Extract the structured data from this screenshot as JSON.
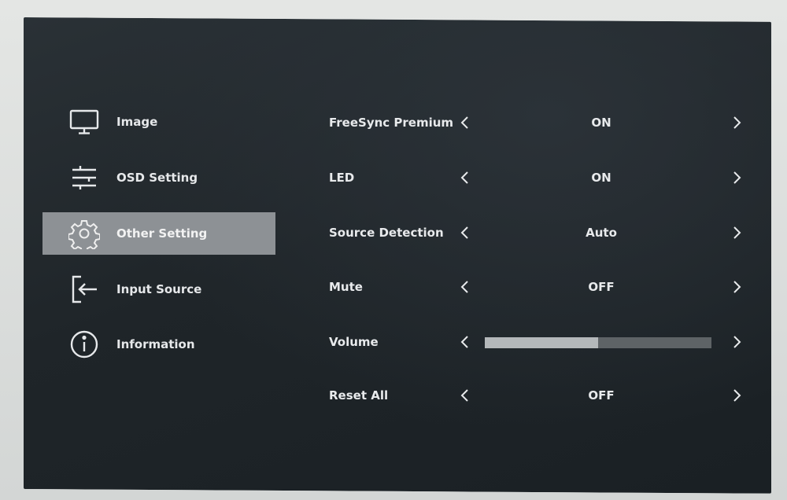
{
  "sidebar": {
    "items": [
      {
        "label": "Image",
        "icon": "monitor-icon",
        "active": false
      },
      {
        "label": "OSD Setting",
        "icon": "sliders-icon",
        "active": false
      },
      {
        "label": "Other Setting",
        "icon": "gear-icon",
        "active": true
      },
      {
        "label": "Input Source",
        "icon": "input-arrow-icon",
        "active": false
      },
      {
        "label": "Information",
        "icon": "info-icon",
        "active": false
      }
    ]
  },
  "settings": {
    "rows": [
      {
        "label": "FreeSync Premium",
        "value": "ON"
      },
      {
        "label": "LED",
        "value": "ON"
      },
      {
        "label": "Source Detection",
        "value": "Auto"
      },
      {
        "label": "Mute",
        "value": "OFF"
      },
      {
        "label": "Volume",
        "value": "",
        "level": 0.5
      },
      {
        "label": "Reset All",
        "value": "OFF"
      }
    ]
  },
  "colors": {
    "background": "#1f2529",
    "active_item": "#8d9195",
    "text": "#e8eaec",
    "slider_track": "#5e6366",
    "slider_fill": "#b4b8ba"
  }
}
